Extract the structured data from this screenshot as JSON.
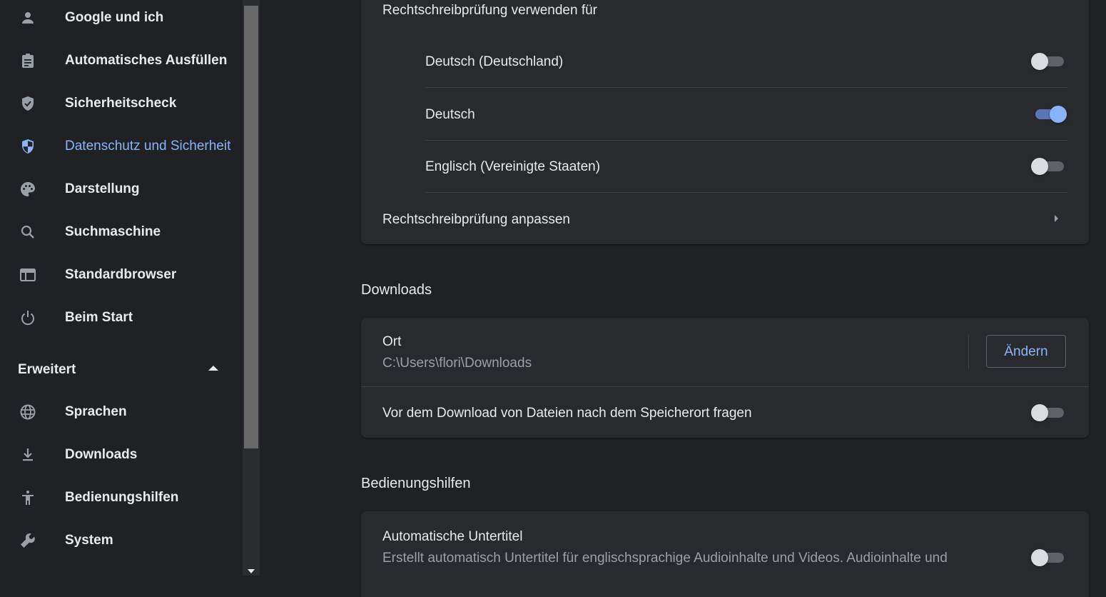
{
  "sidebar": {
    "items": [
      {
        "label": "Google und ich",
        "icon": "person-icon"
      },
      {
        "label": "Automatisches Ausfüllen",
        "icon": "clipboard-icon"
      },
      {
        "label": "Sicherheitscheck",
        "icon": "shield-check-icon"
      },
      {
        "label": "Datenschutz und Sicherheit",
        "icon": "shield-icon",
        "active": true
      },
      {
        "label": "Darstellung",
        "icon": "palette-icon"
      },
      {
        "label": "Suchmaschine",
        "icon": "search-icon"
      },
      {
        "label": "Standardbrowser",
        "icon": "browser-icon"
      },
      {
        "label": "Beim Start",
        "icon": "power-icon"
      }
    ],
    "advanced": {
      "label": "Erweitert",
      "expanded": true,
      "items": [
        {
          "label": "Sprachen",
          "icon": "globe-icon"
        },
        {
          "label": "Downloads",
          "icon": "download-icon"
        },
        {
          "label": "Bedienungshilfen",
          "icon": "accessibility-icon"
        },
        {
          "label": "System",
          "icon": "wrench-icon"
        }
      ]
    }
  },
  "spellcheck": {
    "header": "Rechtschreibprüfung verwenden für",
    "languages": [
      {
        "label": "Deutsch (Deutschland)",
        "enabled": false
      },
      {
        "label": "Deutsch",
        "enabled": true
      },
      {
        "label": "Englisch (Vereinigte Staaten)",
        "enabled": false
      }
    ],
    "customize_label": "Rechtschreibprüfung anpassen"
  },
  "downloads": {
    "heading": "Downloads",
    "location_label": "Ort",
    "location_path": "C:\\Users\\flori\\Downloads",
    "change_button": "Ändern",
    "ask_location_label": "Vor dem Download von Dateien nach dem Speicherort fragen",
    "ask_location_enabled": false
  },
  "accessibility": {
    "heading": "Bedienungshilfen",
    "captions_label": "Automatische Untertitel",
    "captions_desc": "Erstellt automatisch Untertitel für englischsprachige Audioinhalte und Videos. Audioinhalte und",
    "captions_enabled": false
  },
  "colors": {
    "background": "#202124",
    "card": "#292a2d",
    "accent": "#8ab4f8",
    "text": "#e8eaed",
    "secondary_text": "#9aa0a6"
  }
}
